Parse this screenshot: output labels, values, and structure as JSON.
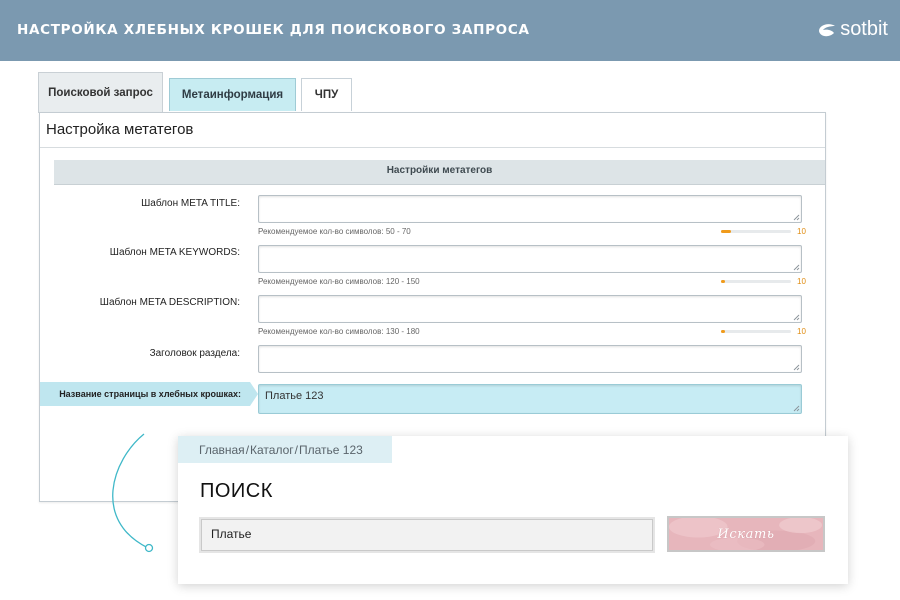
{
  "banner": {
    "title": "НАСТРОЙКА ХЛЕБНЫХ КРОШЕК ДЛЯ ПОИСКОВОГО ЗАПРОСА",
    "brand": "sotbit",
    "color": "#7b99b0"
  },
  "tabs": [
    {
      "label": "Поисковой запрос",
      "active": true
    },
    {
      "label": "Метаинформация",
      "active": false
    },
    {
      "label": "ЧПУ",
      "active": false
    }
  ],
  "panel": {
    "title": "Настройка метатегов",
    "section_title": "Настройки метатегов",
    "fields": [
      {
        "label": "Шаблон META TITLE:",
        "value": "",
        "hint": "Рекомендуемое кол-во символов: 50 - 70",
        "count": "10",
        "fill_fraction": 0.14
      },
      {
        "label": "Шаблон META KEYWORDS:",
        "value": "",
        "hint": "Рекомендуемое кол-во символов: 120 - 150",
        "count": "10",
        "fill_fraction": 0.06
      },
      {
        "label": "Шаблон META DESCRIPTION:",
        "value": "",
        "hint": "Рекомендуемое кол-во символов: 130 - 180",
        "count": "10",
        "fill_fraction": 0.06
      },
      {
        "label": "Заголовок раздела:",
        "value": ""
      },
      {
        "label": "Название страницы в хлебных крошках:",
        "value": "Платье 123"
      }
    ]
  },
  "preview": {
    "breadcrumb": [
      "Главная",
      "Каталог",
      "Платье 123"
    ],
    "breadcrumb_separator": "/",
    "heading": "ПОИСК",
    "search_value": "Платье",
    "search_button": "Искать"
  },
  "colors": {
    "accent": "#c7ecf4",
    "meter": "#f09b1b",
    "button": "#e8b9bf"
  }
}
